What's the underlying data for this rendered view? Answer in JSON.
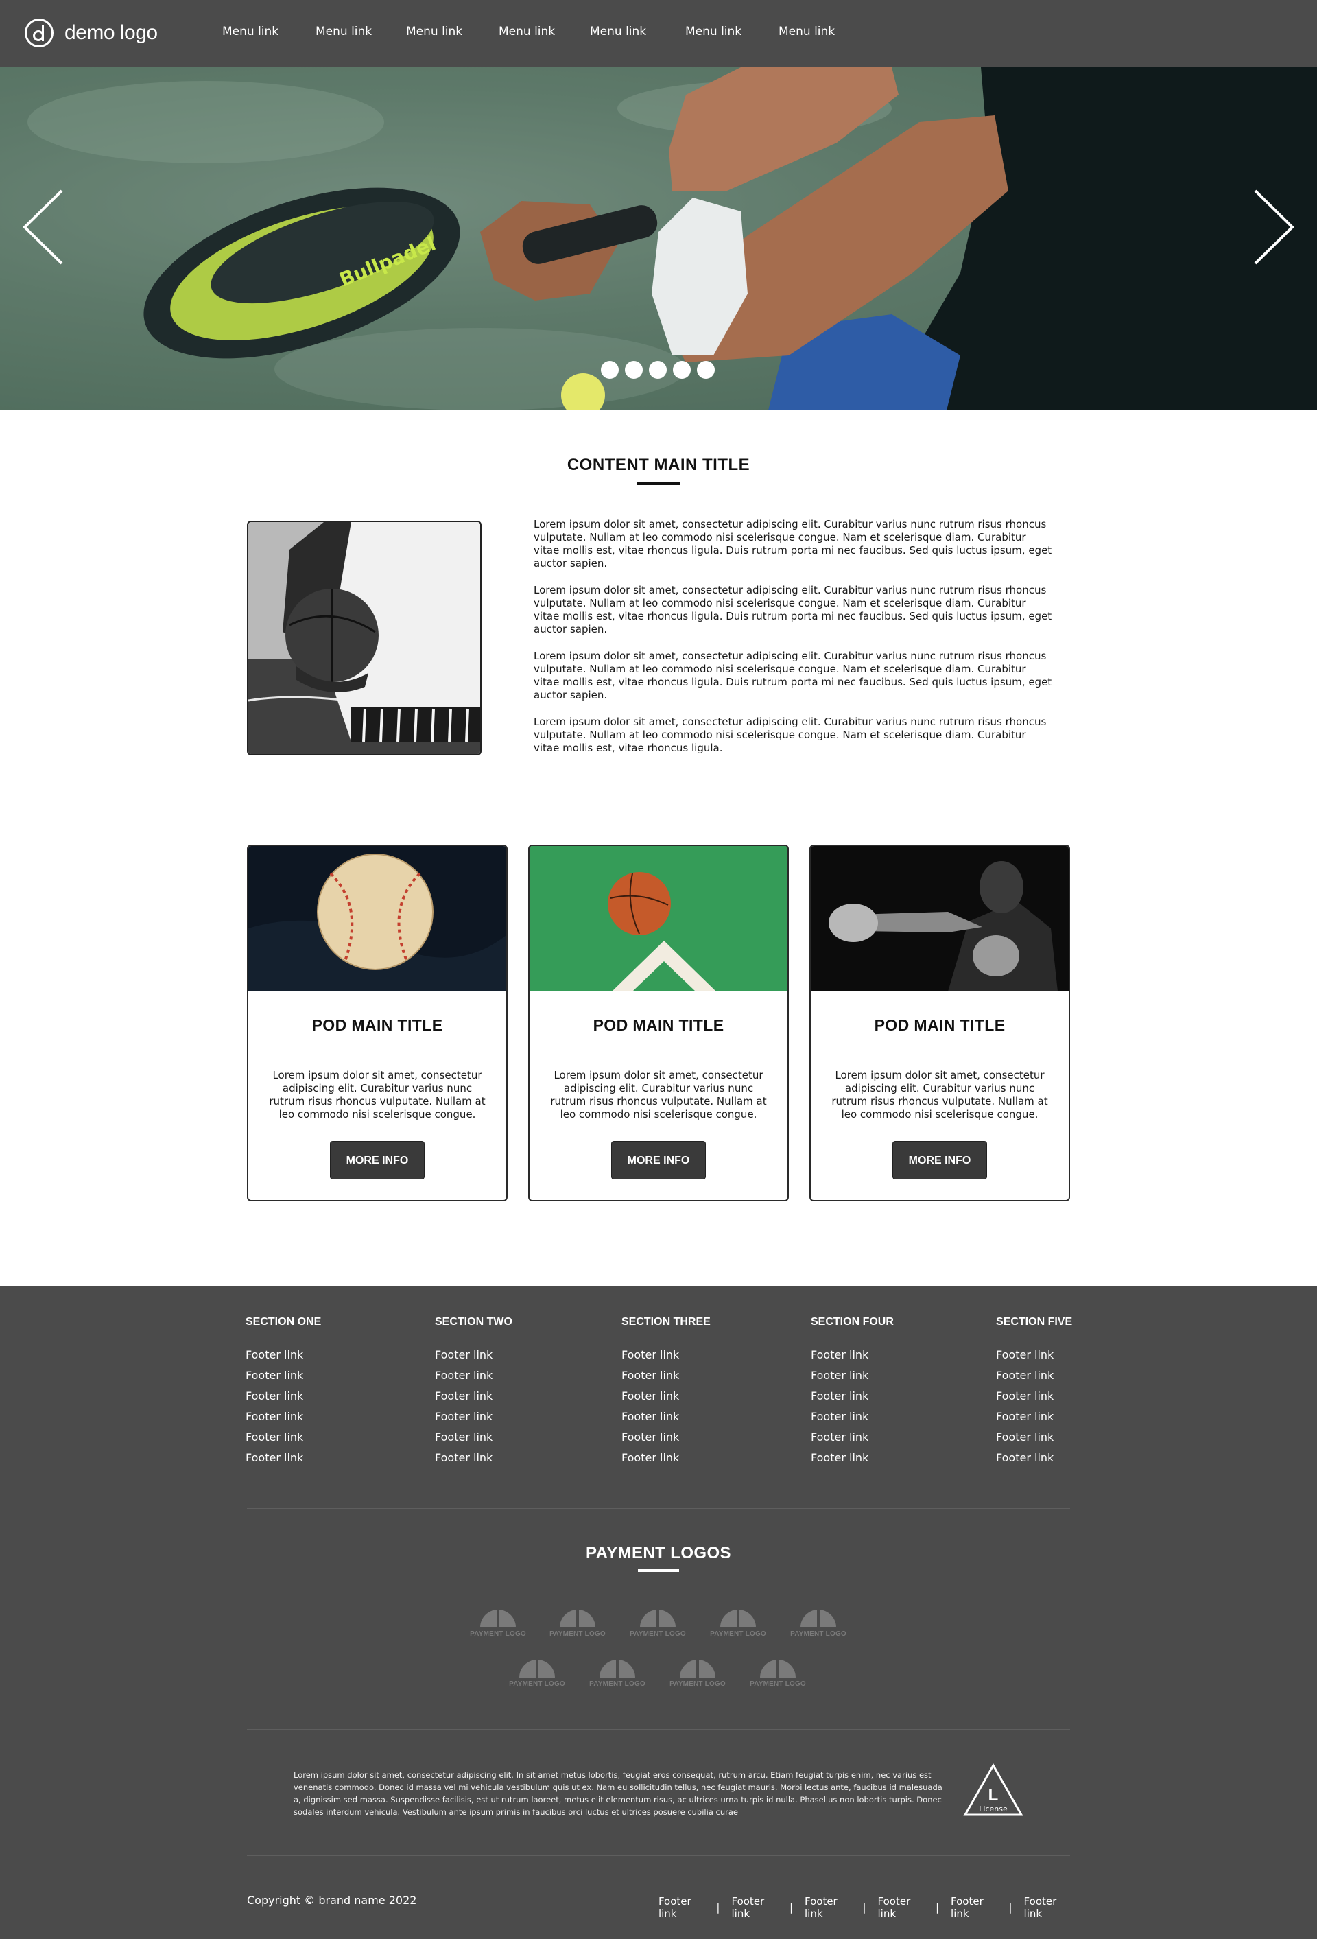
{
  "header": {
    "logo_text": "demo logo",
    "menu": [
      "Menu link",
      "Menu link",
      "Menu link",
      "Menu link",
      "Menu link",
      "Menu link",
      "Menu link"
    ]
  },
  "hero": {
    "slide_count": 5,
    "racket_text": "Bullpadel",
    "prev_icon": "chevron-left-icon",
    "next_icon": "chevron-right-icon"
  },
  "content": {
    "title": "CONTENT MAIN TITLE",
    "paragraphs": [
      "Lorem ipsum dolor sit amet, consectetur adipiscing elit. Curabitur varius nunc rutrum risus rhoncus vulputate. Nullam at leo commodo nisi scelerisque congue. Nam et scelerisque diam. Curabitur vitae mollis est, vitae rhoncus ligula. Duis rutrum porta mi nec faucibus. Sed quis luctus ipsum, eget auctor sapien.",
      "Lorem ipsum dolor sit amet, consectetur adipiscing elit. Curabitur varius nunc rutrum risus rhoncus vulputate. Nullam at leo commodo nisi scelerisque congue. Nam et scelerisque diam. Curabitur vitae mollis est, vitae rhoncus ligula. Duis rutrum porta mi nec faucibus. Sed quis luctus ipsum, eget auctor sapien.",
      "Lorem ipsum dolor sit amet, consectetur adipiscing elit. Curabitur varius nunc rutrum risus rhoncus vulputate. Nullam at leo commodo nisi scelerisque congue. Nam et scelerisque diam. Curabitur vitae mollis est, vitae rhoncus ligula. Duis rutrum porta mi nec faucibus. Sed quis luctus ipsum, eget auctor sapien.",
      "Lorem ipsum dolor sit amet, consectetur adipiscing elit. Curabitur varius nunc rutrum risus rhoncus vulputate. Nullam at leo commodo nisi scelerisque congue. Nam et scelerisque diam. Curabitur vitae mollis est, vitae rhoncus ligula."
    ]
  },
  "pods": [
    {
      "title": "POD MAIN TITLE",
      "text": "Lorem ipsum dolor sit amet, consectetur adipiscing elit. Curabitur varius nunc rutrum risus rhoncus vulputate. Nullam at leo commodo nisi scelerisque congue.",
      "button": "MORE INFO"
    },
    {
      "title": "POD MAIN TITLE",
      "text": "Lorem ipsum dolor sit amet, consectetur adipiscing elit. Curabitur varius nunc rutrum risus rhoncus vulputate. Nullam at leo commodo nisi scelerisque congue.",
      "button": "MORE INFO"
    },
    {
      "title": "POD MAIN TITLE",
      "text": "Lorem ipsum dolor sit amet, consectetur adipiscing elit. Curabitur varius nunc rutrum risus rhoncus vulputate. Nullam at leo commodo nisi scelerisque congue.",
      "button": "MORE INFO"
    }
  ],
  "footer": {
    "sections": [
      {
        "title": "SECTION ONE",
        "links": [
          "Footer link",
          "Footer link",
          "Footer link",
          "Footer link",
          "Footer link",
          "Footer link"
        ]
      },
      {
        "title": "SECTION TWO",
        "links": [
          "Footer link",
          "Footer link",
          "Footer link",
          "Footer link",
          "Footer link",
          "Footer link"
        ]
      },
      {
        "title": "SECTION THREE",
        "links": [
          "Footer link",
          "Footer link",
          "Footer link",
          "Footer link",
          "Footer link",
          "Footer link"
        ]
      },
      {
        "title": "SECTION FOUR",
        "links": [
          "Footer link",
          "Footer link",
          "Footer link",
          "Footer link",
          "Footer link",
          "Footer link"
        ]
      },
      {
        "title": "SECTION FIVE",
        "links": [
          "Footer link",
          "Footer link",
          "Footer link",
          "Footer link",
          "Footer link",
          "Footer link"
        ]
      }
    ],
    "payment_title": "PAYMENT LOGOS",
    "payment_logos": [
      "PAYMENT LOGO",
      "PAYMENT LOGO",
      "PAYMENT LOGO",
      "PAYMENT LOGO",
      "PAYMENT LOGO",
      "PAYMENT LOGO",
      "PAYMENT LOGO",
      "PAYMENT LOGO",
      "PAYMENT LOGO"
    ],
    "legal_text": "Lorem ipsum dolor sit amet, consectetur adipiscing elit. In sit amet metus lobortis, feugiat eros consequat, rutrum arcu. Etiam feugiat turpis enim, nec varius est venenatis commodo. Donec id massa vel mi vehicula vestibulum quis ut ex. Nam eu sollicitudin tellus, nec feugiat mauris. Morbi lectus ante, faucibus id malesuada a, dignissim sed massa. Suspendisse facilisis, est ut rutrum laoreet, metus elit elementum risus, ac ultrices urna turpis id nulla. Phasellus non lobortis turpis. Donec sodales interdum vehicula. Vestibulum ante ipsum primis in faucibus orci luctus et ultrices posuere cubilia curae",
    "license_letter": "L",
    "license_label": "License",
    "copyright": "Copyright © brand name 2022",
    "bottom_links": [
      "Footer link",
      "Footer link",
      "Footer link",
      "Footer link",
      "Footer link",
      "Footer link"
    ],
    "separator": "|"
  },
  "colors": {
    "header_bg": "#4b4b4b",
    "footer_bg": "#4b4b4b",
    "button_bg": "#3a3a3a",
    "racket_accent": "#c8e84a"
  }
}
